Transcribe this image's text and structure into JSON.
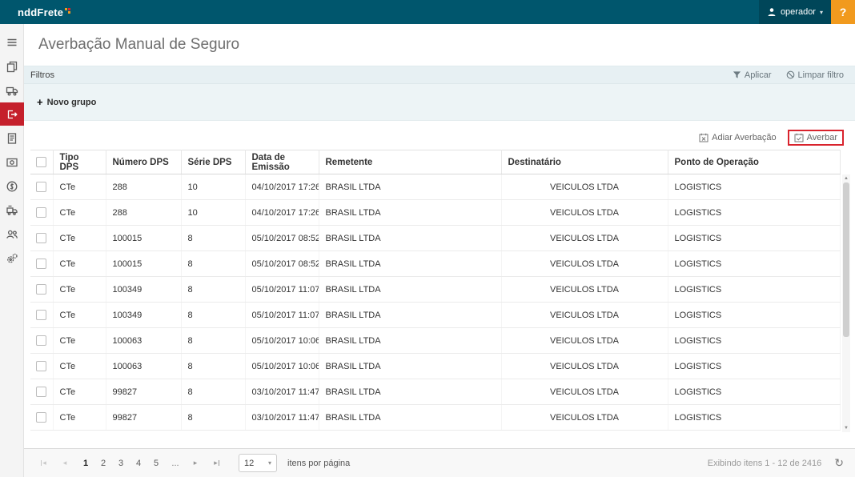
{
  "topbar": {
    "brand": "nddFrete",
    "user_label": "operador",
    "help_label": "?"
  },
  "page": {
    "title": "Averbação Manual de Seguro"
  },
  "filters": {
    "title": "Filtros",
    "apply_label": "Aplicar",
    "clear_label": "Limpar filtro",
    "new_group_plus": "+",
    "new_group_label": "Novo grupo"
  },
  "grid_actions": {
    "postpone_label": "Adiar Averbação",
    "endorse_label": "Averbar"
  },
  "sidebar": {
    "icons": [
      "menu-icon",
      "documents-icon",
      "truck-icon",
      "endorsement-icon",
      "report-icon",
      "monitor-icon",
      "billing-icon",
      "fleet-icon",
      "users-icon",
      "settings-icon"
    ],
    "active": "endorsement-icon"
  },
  "table": {
    "columns": [
      "Tipo DPS",
      "Número DPS",
      "Série DPS",
      "Data de Emissão",
      "Remetente",
      "Destinatário",
      "Ponto de Operação"
    ],
    "rows": [
      {
        "tipo": "CTe",
        "numero": "288",
        "serie": "10",
        "emissao": "04/10/2017 17:26",
        "remetente": "BRASIL LTDA",
        "destinatario": "VEICULOS LTDA",
        "ponto": "LOGISTICS"
      },
      {
        "tipo": "CTe",
        "numero": "288",
        "serie": "10",
        "emissao": "04/10/2017 17:26",
        "remetente": "BRASIL LTDA",
        "destinatario": "VEICULOS LTDA",
        "ponto": "LOGISTICS"
      },
      {
        "tipo": "CTe",
        "numero": "100015",
        "serie": "8",
        "emissao": "05/10/2017 08:52",
        "remetente": "BRASIL LTDA",
        "destinatario": "VEICULOS LTDA",
        "ponto": "LOGISTICS"
      },
      {
        "tipo": "CTe",
        "numero": "100015",
        "serie": "8",
        "emissao": "05/10/2017 08:52",
        "remetente": "BRASIL LTDA",
        "destinatario": "VEICULOS LTDA",
        "ponto": "LOGISTICS"
      },
      {
        "tipo": "CTe",
        "numero": "100349",
        "serie": "8",
        "emissao": "05/10/2017 11:07",
        "remetente": "BRASIL LTDA",
        "destinatario": "VEICULOS LTDA",
        "ponto": "LOGISTICS"
      },
      {
        "tipo": "CTe",
        "numero": "100349",
        "serie": "8",
        "emissao": "05/10/2017 11:07",
        "remetente": "BRASIL LTDA",
        "destinatario": "VEICULOS LTDA",
        "ponto": "LOGISTICS"
      },
      {
        "tipo": "CTe",
        "numero": "100063",
        "serie": "8",
        "emissao": "05/10/2017 10:06",
        "remetente": "BRASIL LTDA",
        "destinatario": "VEICULOS LTDA",
        "ponto": "LOGISTICS"
      },
      {
        "tipo": "CTe",
        "numero": "100063",
        "serie": "8",
        "emissao": "05/10/2017 10:06",
        "remetente": "BRASIL LTDA",
        "destinatario": "VEICULOS LTDA",
        "ponto": "LOGISTICS"
      },
      {
        "tipo": "CTe",
        "numero": "99827",
        "serie": "8",
        "emissao": "03/10/2017 11:47",
        "remetente": "BRASIL LTDA",
        "destinatario": "VEICULOS LTDA",
        "ponto": "LOGISTICS"
      },
      {
        "tipo": "CTe",
        "numero": "99827",
        "serie": "8",
        "emissao": "03/10/2017 11:47",
        "remetente": "BRASIL LTDA",
        "destinatario": "VEICULOS LTDA",
        "ponto": "LOGISTICS"
      }
    ]
  },
  "pagination": {
    "pages": [
      "1",
      "2",
      "3",
      "4",
      "5"
    ],
    "current_page": "1",
    "ellipsis": "...",
    "page_size": "12",
    "page_size_label": "itens por página",
    "summary": "Exibindo itens 1 - 12 de 2416"
  },
  "colors": {
    "topbar": "#00566d",
    "help_button": "#f19a1e",
    "active_sidebar_item": "#c5202c",
    "highlight_red": "#d9232d"
  }
}
